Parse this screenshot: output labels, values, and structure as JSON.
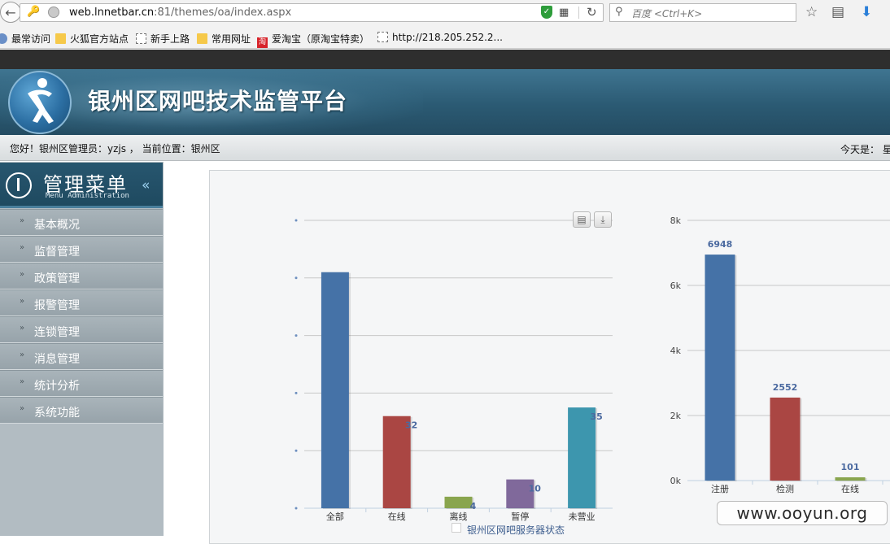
{
  "browser": {
    "url_domain": "web.lnnetbar.cn",
    "url_rest": ":81/themes/oa/index.aspx",
    "search_placeholder": "百度 <Ctrl+K>",
    "bookmarks": [
      {
        "label": "最常访问",
        "icon": "gear"
      },
      {
        "label": "火狐官方站点",
        "icon": "folder"
      },
      {
        "label": "新手上路",
        "icon": "blank"
      },
      {
        "label": "常用网址",
        "icon": "folder"
      },
      {
        "label": "爱淘宝（原淘宝特卖）",
        "icon": "taobao"
      },
      {
        "label": "http://218.205.252.2...",
        "icon": "blank"
      }
    ]
  },
  "header": {
    "site_title": "银州区网吧技术监管平台",
    "greeting": "您好！银州区管理员：yzjs ， 当前位置：银州区",
    "today_label": "今天是： 星"
  },
  "sidebar": {
    "title": "管理菜单",
    "subtitle": "Menu Administration",
    "items": [
      {
        "label": "基本概况"
      },
      {
        "label": "监督管理"
      },
      {
        "label": "政策管理"
      },
      {
        "label": "报警管理"
      },
      {
        "label": "连锁管理"
      },
      {
        "label": "消息管理"
      },
      {
        "label": "统计分析"
      },
      {
        "label": "系统功能"
      }
    ]
  },
  "chart_data": [
    {
      "type": "bar",
      "title": "银州区网吧服务器状态",
      "categories": [
        "全部",
        "在线",
        "离线",
        "暂停",
        "未营业"
      ],
      "values": [
        82,
        32,
        4,
        10,
        35
      ],
      "value_labels": [
        "",
        "32",
        "4",
        "10",
        "35"
      ],
      "colors": [
        "#4572a7",
        "#aa4643",
        "#89a54e",
        "#80699b",
        "#3d96ae"
      ],
      "ylim": [
        0,
        100
      ],
      "grid": true,
      "legend": "bottom-center"
    },
    {
      "type": "bar",
      "categories": [
        "注册",
        "检测",
        "在线"
      ],
      "values": [
        6948,
        2552,
        101
      ],
      "value_labels": [
        "6948",
        "2552",
        "101"
      ],
      "colors": [
        "#4572a7",
        "#aa4643",
        "#89a54e"
      ],
      "yticks": [
        "0k",
        "2k",
        "4k",
        "6k",
        "8k"
      ],
      "ylim": [
        0,
        8000
      ],
      "grid": true
    }
  ],
  "watermark": "www.ooyun.org"
}
